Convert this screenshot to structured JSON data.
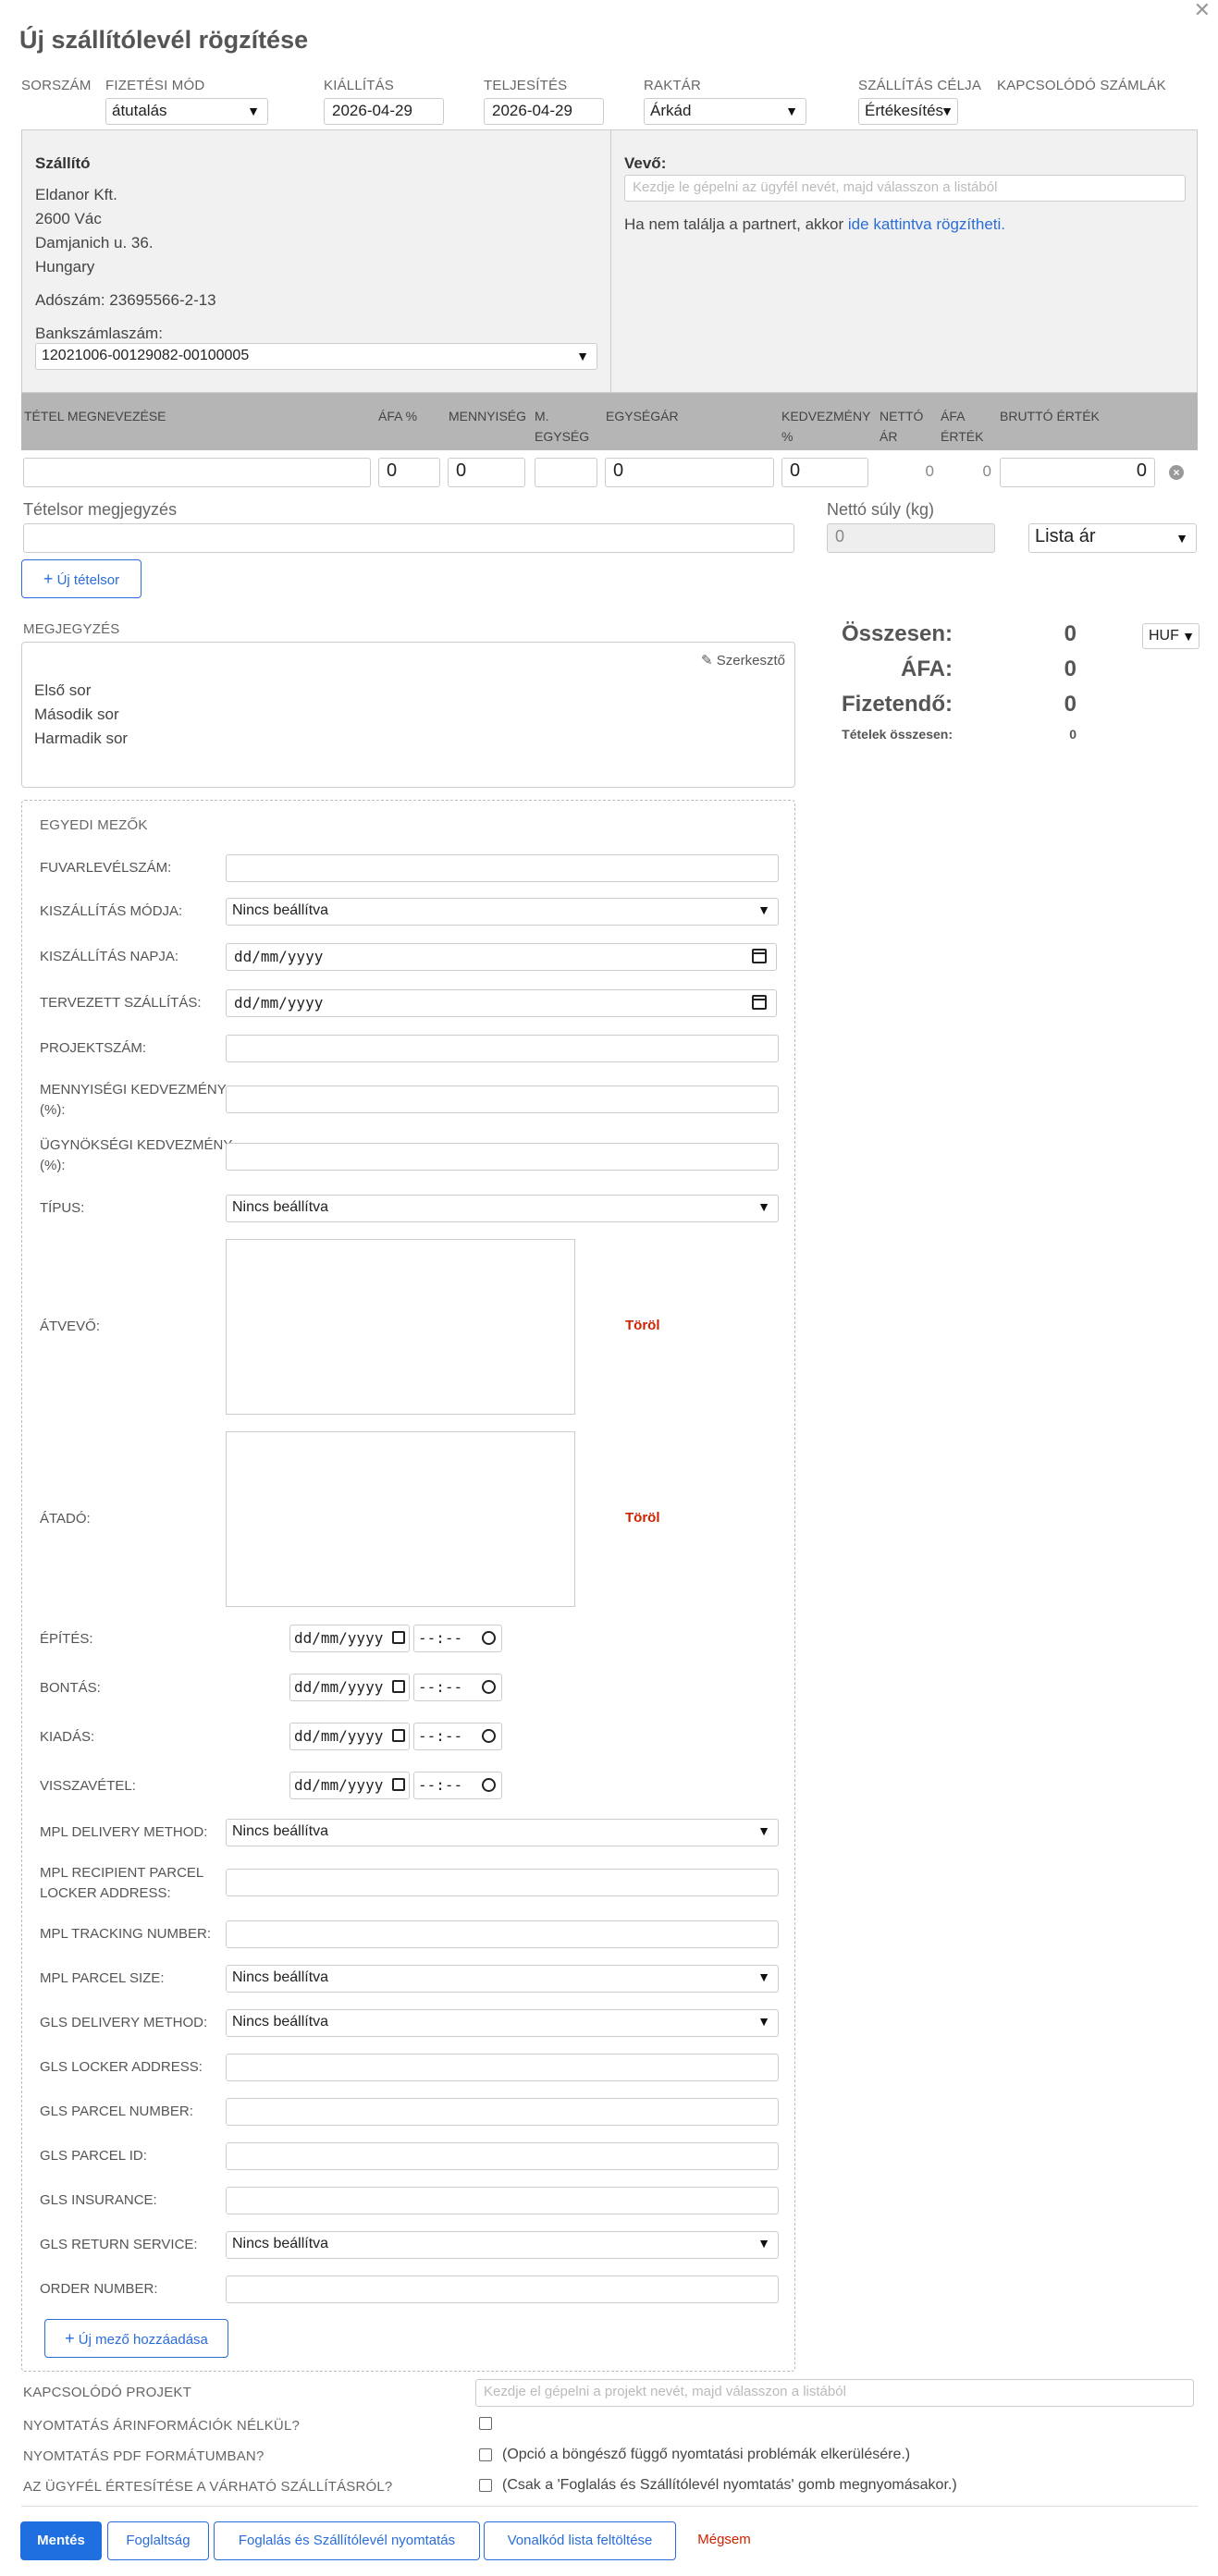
{
  "title": "Új szállítólevél rögzítése",
  "header": {
    "sorszam_label": "SORSZÁM",
    "fizetesi_mod_label": "FIZETÉSI MÓD",
    "fizetesi_mod_value": "átutalás",
    "kiallitas_label": "KIÁLLÍTÁS",
    "kiallitas_value": "2026-04-29",
    "teljesites_label": "TELJESÍTÉS",
    "teljesites_value": "2026-04-29",
    "raktar_label": "RAKTÁR",
    "raktar_value": "Árkád",
    "szallitas_celja_label": "SZÁLLÍTÁS CÉLJA",
    "szallitas_celja_value": "Értékesítés",
    "kapcsolodo_szamlak_label": "KAPCSOLÓDÓ SZÁMLÁK"
  },
  "supplier": {
    "heading": "Szállító",
    "name": "Eldanor Kft.",
    "city": "2600 Vác",
    "street": "Damjanich u. 36.",
    "country": "Hungary",
    "tax": "Adószám: 23695566-2-13",
    "bank_label": "Bankszámlaszám:",
    "bank_value": "12021006-00129082-00100005"
  },
  "buyer": {
    "heading": "Vevő:",
    "placeholder": "Kezdje le gépelni az ügyfél nevét, majd válasszon a listából",
    "hint": "Ha nem találja a partnert, akkor",
    "hint_link": "ide kattintva rögzítheti."
  },
  "items_header": {
    "name": "TÉTEL MEGNEVEZÉSE",
    "vat": "ÁFA %",
    "qty": "MENNYISÉG",
    "unit_1": "M.",
    "unit_2": "EGYSÉG",
    "unit_price": "EGYSÉGÁR",
    "discount_1": "KEDVEZMÉNY",
    "discount_2": "%",
    "net_1": "NETTÓ",
    "net_2": "ÁR",
    "vat_val_1": "ÁFA",
    "vat_val_2": "ÉRTÉK",
    "gross": "BRUTTÓ ÉRTÉK"
  },
  "item_row": {
    "vat": "0",
    "qty": "0",
    "unit_price": "0",
    "discount": "0",
    "net": "0",
    "vat_value": "0",
    "gross": "0"
  },
  "row_note_label": "Tételsor megjegyzés",
  "net_weight_label": "Nettó súly (kg)",
  "net_weight_value": "0",
  "price_list_value": "Lista ár",
  "new_row_button": "Új tételsor",
  "note": {
    "label": "MEGJEGYZÉS",
    "edit": "Szerkesztő",
    "lines": [
      "Első sor",
      "Második sor",
      "Harmadik sor"
    ]
  },
  "summary": {
    "total_label": "Összesen:",
    "total_value": "0",
    "currency": "HUF",
    "vat_label": "ÁFA:",
    "vat_value": "0",
    "payable_label": "Fizetendő:",
    "payable_value": "0",
    "items_total_label": "Tételek összesen:",
    "items_total_value": "0"
  },
  "custom": {
    "heading": "EGYEDI MEZŐK",
    "fuvarlevel": "FUVARLEVÉLSZÁM:",
    "kiszallitas_modja": "KISZÁLLÍTÁS MÓDJA:",
    "kiszallitas_modja_value": "Nincs beállítva",
    "kiszallitas_napja": "KISZÁLLÍTÁS NAPJA:",
    "tervezett": "TERVEZETT SZÁLLÍTÁS:",
    "projektszam": "PROJEKTSZÁM:",
    "mennyisegi_1": "MENNYISÉGI KEDVEZMÉNY",
    "mennyisegi_2": "(%):",
    "ugynoksegi_1": "ÜGYNÖKSÉGI KEDVEZMÉNY",
    "ugynoksegi_2": "(%):",
    "tipus": "TÍPUS:",
    "tipus_value": "Nincs beállítva",
    "atvevo": "ÁTVEVŐ:",
    "atado": "ÁTADÓ:",
    "torol": "Töröl",
    "epites": "ÉPÍTÉS:",
    "bontas": "BONTÁS:",
    "kiadas": "KIADÁS:",
    "visszavetel": "VISSZAVÉTEL:",
    "date_ph": "dd/mm/yyyy",
    "time_ph": "--:--",
    "mpl_delivery": "MPL DELIVERY METHOD:",
    "mpl_delivery_value": "Nincs beállítva",
    "mpl_locker_1": "MPL RECIPIENT PARCEL",
    "mpl_locker_2": "LOCKER ADDRESS:",
    "mpl_tracking": "MPL TRACKING NUMBER:",
    "mpl_size": "MPL PARCEL SIZE:",
    "mpl_size_value": "Nincs beállítva",
    "gls_delivery": "GLS DELIVERY METHOD:",
    "gls_delivery_value": "Nincs beállítva",
    "gls_locker": "GLS LOCKER ADDRESS:",
    "gls_parcel_number": "GLS PARCEL NUMBER:",
    "gls_parcel_id": "GLS PARCEL ID:",
    "gls_insurance": "GLS INSURANCE:",
    "gls_return": "GLS RETURN SERVICE:",
    "gls_return_value": "Nincs beállítva",
    "order_number": "ORDER NUMBER:",
    "add_field": "Új mező hozzáadása"
  },
  "footer": {
    "project_label": "KAPCSOLÓDÓ PROJEKT",
    "project_placeholder": "Kezdje el gépelni a projekt nevét, majd válasszon a listából",
    "no_price_label": "NYOMTATÁS ÁRINFORMÁCIÓK NÉLKÜL?",
    "pdf_label": "NYOMTATÁS PDF FORMÁTUMBAN?",
    "pdf_note": "(Opció a böngésző függő nyomtatási problémák elkerülésére.)",
    "notify_label": "AZ ÜGYFÉL ÉRTESÍTÉSE A VÁRHATÓ SZÁLLÍTÁSRÓL?",
    "notify_note": "(Csak a 'Foglalás és Szállítólevél nyomtatás' gomb megnyomásakor.)"
  },
  "buttons": {
    "save": "Mentés",
    "reserve": "Foglaltság",
    "reserve_print": "Foglalás és Szállítólevél nyomtatás",
    "barcode": "Vonalkód lista feltöltése",
    "cancel": "Mégsem"
  }
}
